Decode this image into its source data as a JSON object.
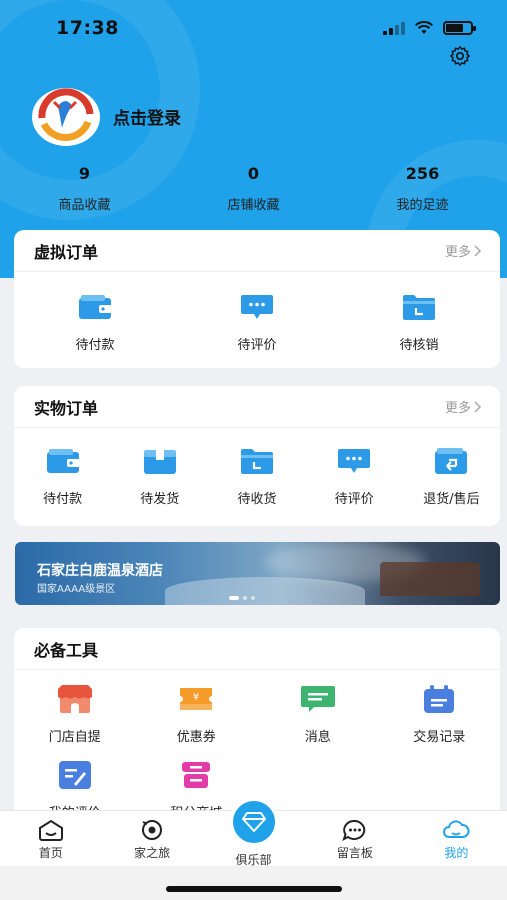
{
  "status_bar": {
    "time": "17:38"
  },
  "header": {
    "login_text": "点击登录"
  },
  "stats": [
    {
      "value": "9",
      "label": "商品收藏"
    },
    {
      "value": "0",
      "label": "店铺收藏"
    },
    {
      "value": "256",
      "label": "我的足迹"
    }
  ],
  "virtual_orders": {
    "title": "虚拟订单",
    "more": "更多",
    "items": [
      {
        "label": "待付款",
        "icon": "wallet-icon"
      },
      {
        "label": "待评价",
        "icon": "comment-icon"
      },
      {
        "label": "待核销",
        "icon": "folder-check-icon"
      }
    ]
  },
  "physical_orders": {
    "title": "实物订单",
    "more": "更多",
    "items": [
      {
        "label": "待付款",
        "icon": "wallet-icon"
      },
      {
        "label": "待发货",
        "icon": "box-icon"
      },
      {
        "label": "待收货",
        "icon": "folder-check-icon"
      },
      {
        "label": "待评价",
        "icon": "comment-icon"
      },
      {
        "label": "退货/售后",
        "icon": "return-icon"
      }
    ]
  },
  "banner": {
    "title": "石家庄白鹿温泉酒店",
    "subtitle": "国家AAAA级景区"
  },
  "tools": {
    "title": "必备工具",
    "items": [
      {
        "label": "门店自提",
        "icon": "store-icon"
      },
      {
        "label": "优惠券",
        "icon": "coupon-icon"
      },
      {
        "label": "消息",
        "icon": "message-icon"
      },
      {
        "label": "交易记录",
        "icon": "calendar-icon"
      },
      {
        "label": "我的评价",
        "icon": "edit-icon"
      },
      {
        "label": "积分商城",
        "icon": "points-icon"
      }
    ]
  },
  "tabbar": {
    "items": [
      {
        "label": "首页",
        "icon": "home-icon"
      },
      {
        "label": "家之旅",
        "icon": "journey-icon"
      },
      {
        "label": "俱乐部",
        "icon": "diamond-icon"
      },
      {
        "label": "留言板",
        "icon": "chat-icon"
      },
      {
        "label": "我的",
        "icon": "cloud-icon"
      }
    ],
    "active": "我的"
  },
  "colors": {
    "primary": "#1fa2ea",
    "icon_blue": "#2c9ae6",
    "coupon": "#f59b2a",
    "message": "#3db570",
    "points": "#e23ca8",
    "store": "#e8553e"
  }
}
